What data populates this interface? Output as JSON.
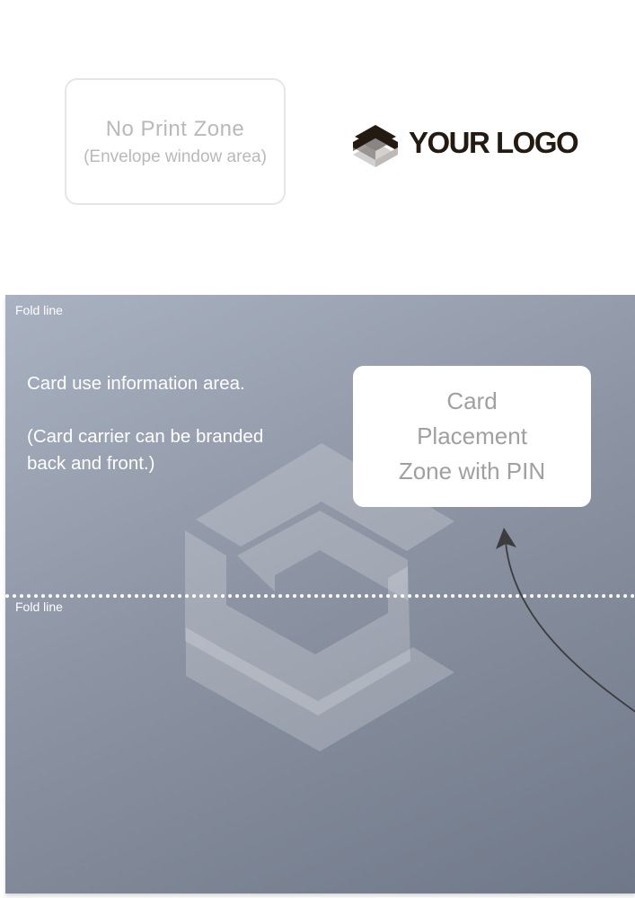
{
  "no_print_zone": {
    "title": "No Print Zone",
    "subtitle": "(Envelope window area)"
  },
  "logo": {
    "text": "YOUR LOGO",
    "icon": "hexagon-s-logo-icon",
    "colors": {
      "dark": "#231a12",
      "mid": "#8a8582",
      "light": "#d3d1cf"
    }
  },
  "panel": {
    "fold_line_top": "Fold line",
    "fold_line_middle": "Fold line",
    "info_line1": "Card use information area.",
    "info_line2": "(Card carrier can be branded",
    "info_line3": "back and front.)",
    "card_zone": {
      "line1": "Card",
      "line2": "Placement",
      "line3": "Zone with PIN"
    },
    "background_colors": [
      "#a9b2c1",
      "#8d95a4",
      "#6f7888"
    ],
    "watermark_icon": "hexagon-s-watermark-icon",
    "arrow_icon": "curved-arrow-icon"
  }
}
